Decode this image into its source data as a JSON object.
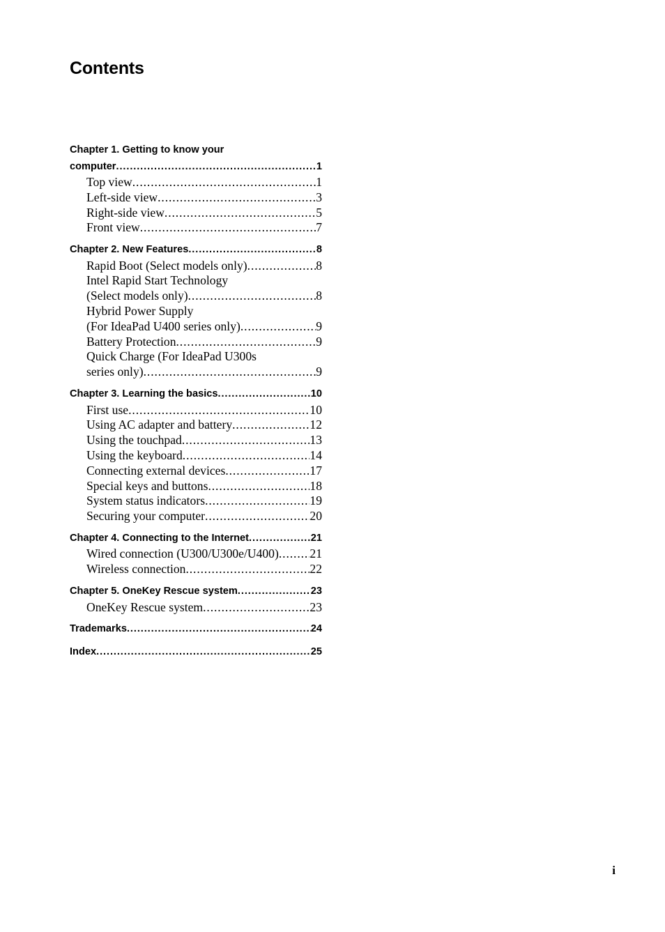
{
  "document": {
    "title": "Contents",
    "folio": "i"
  },
  "toc": {
    "sections": [
      {
        "type": "chapter",
        "name": "chapter-1",
        "lines": [
          "Chapter 1. Getting to know your",
          "computer"
        ],
        "page": "1",
        "entries": [
          {
            "lines": [
              "Top view "
            ],
            "page": "1"
          },
          {
            "lines": [
              "Left-side view "
            ],
            "page": "3"
          },
          {
            "lines": [
              "Right-side view"
            ],
            "page": "5"
          },
          {
            "lines": [
              "Front view "
            ],
            "page": "7"
          }
        ]
      },
      {
        "type": "chapter",
        "name": "chapter-2",
        "lines": [
          "Chapter 2. New Features "
        ],
        "page": "8",
        "entries": [
          {
            "lines": [
              "Rapid Boot (Select models only) "
            ],
            "page": "8"
          },
          {
            "lines": [
              "Intel Rapid Start Technology",
              "(Select models only) "
            ],
            "page": "8"
          },
          {
            "lines": [
              "Hybrid Power Supply",
              "(For IdeaPad U400 series only) "
            ],
            "page": "9"
          },
          {
            "lines": [
              "Battery Protection"
            ],
            "page": "9"
          },
          {
            "lines": [
              "Quick Charge (For IdeaPad U300s",
              "series only) "
            ],
            "page": "9"
          }
        ]
      },
      {
        "type": "chapter",
        "name": "chapter-3",
        "lines": [
          "Chapter 3. Learning the basics"
        ],
        "page": "10",
        "entries": [
          {
            "lines": [
              "First use"
            ],
            "page": "10"
          },
          {
            "lines": [
              "Using AC adapter and battery "
            ],
            "page": "12"
          },
          {
            "lines": [
              "Using the touchpad"
            ],
            "page": "13"
          },
          {
            "lines": [
              "Using the keyboard"
            ],
            "page": "14"
          },
          {
            "lines": [
              "Connecting external devices"
            ],
            "page": "17"
          },
          {
            "lines": [
              "Special keys and buttons"
            ],
            "page": "18"
          },
          {
            "lines": [
              "System status indicators"
            ],
            "page": "19"
          },
          {
            "lines": [
              "Securing your computer"
            ],
            "page": "20"
          }
        ]
      },
      {
        "type": "chapter",
        "name": "chapter-4",
        "lines": [
          "Chapter 4. Connecting to the Internet "
        ],
        "page": "21",
        "entries": [
          {
            "lines": [
              "Wired connection (U300/U300e/U400)"
            ],
            "page": "21"
          },
          {
            "lines": [
              "Wireless connection "
            ],
            "page": "22"
          }
        ]
      },
      {
        "type": "chapter",
        "name": "chapter-5",
        "lines": [
          "Chapter 5. OneKey Rescue system"
        ],
        "page": "23",
        "entries": [
          {
            "lines": [
              "OneKey Rescue system "
            ],
            "page": "23"
          }
        ]
      },
      {
        "type": "chapter",
        "name": "trademarks",
        "lines": [
          "Trademarks"
        ],
        "page": "24",
        "entries": []
      },
      {
        "type": "chapter",
        "name": "index",
        "lines": [
          "Index"
        ],
        "page": "25",
        "entries": []
      }
    ]
  }
}
